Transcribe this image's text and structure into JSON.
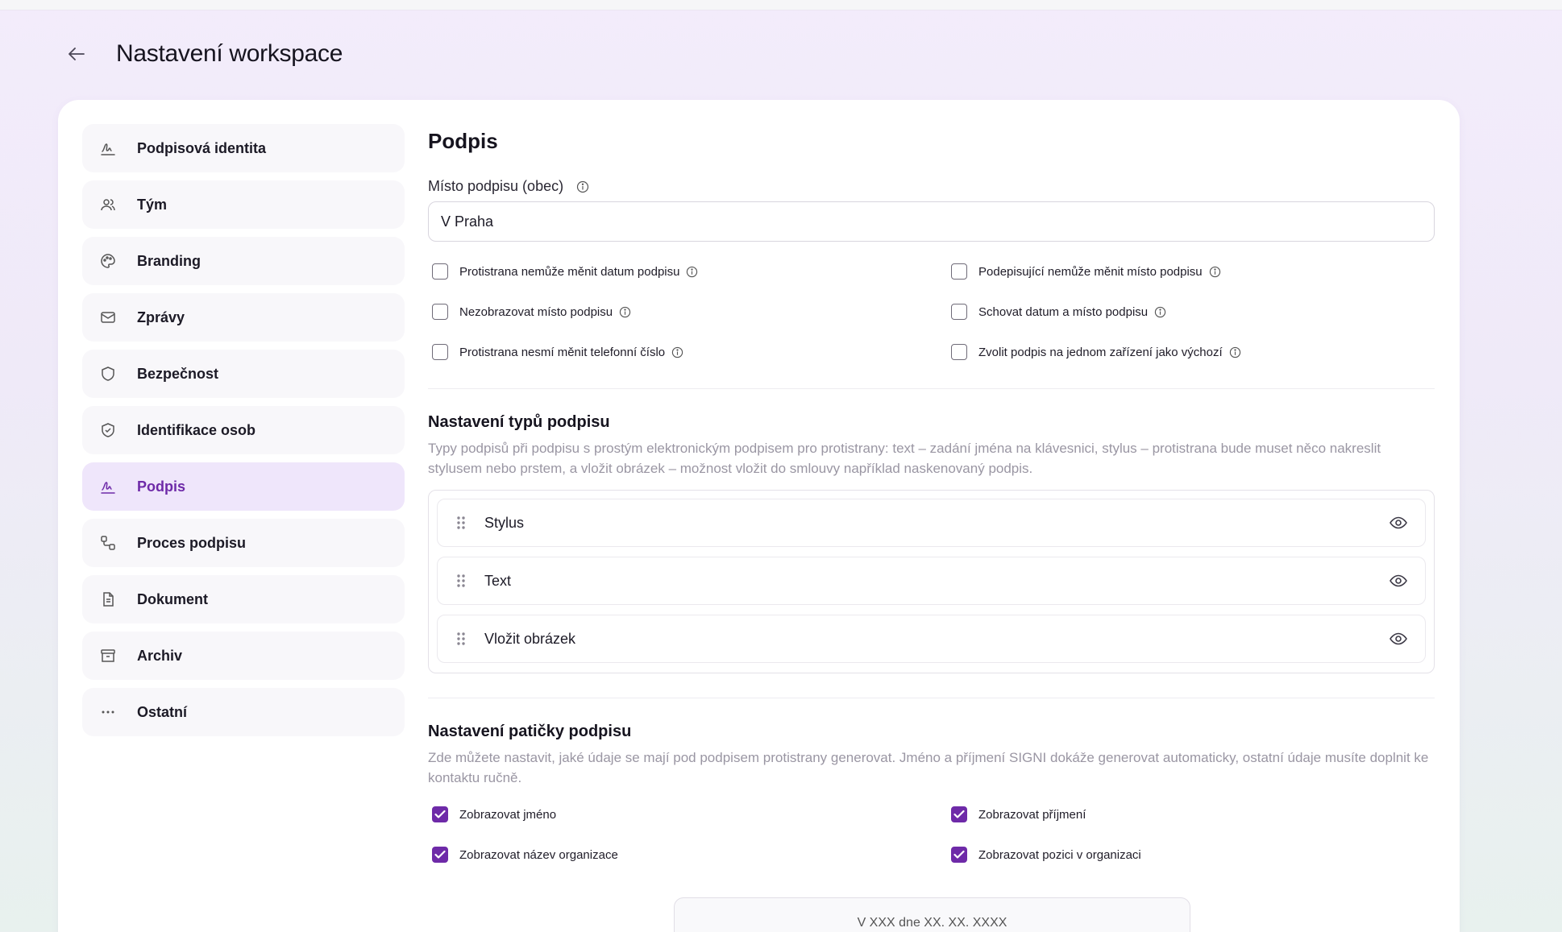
{
  "header": {
    "title": "Nastavení workspace"
  },
  "sidebar": {
    "items": [
      {
        "label": "Podpisová identita",
        "icon": "signature-icon"
      },
      {
        "label": "Tým",
        "icon": "users-icon"
      },
      {
        "label": "Branding",
        "icon": "palette-icon"
      },
      {
        "label": "Zprávy",
        "icon": "mail-icon"
      },
      {
        "label": "Bezpečnost",
        "icon": "shield-icon"
      },
      {
        "label": "Identifikace osob",
        "icon": "shield-check-icon"
      },
      {
        "label": "Podpis",
        "icon": "signature-icon",
        "active": true
      },
      {
        "label": "Proces podpisu",
        "icon": "workflow-icon"
      },
      {
        "label": "Dokument",
        "icon": "document-icon"
      },
      {
        "label": "Archiv",
        "icon": "archive-icon"
      },
      {
        "label": "Ostatní",
        "icon": "more-icon"
      }
    ]
  },
  "main": {
    "title": "Podpis",
    "place": {
      "label": "Místo podpisu (obec)",
      "value": "V Praha"
    },
    "options": [
      {
        "label": "Protistrana nemůže měnit datum podpisu",
        "checked": false
      },
      {
        "label": "Podepisující nemůže měnit místo podpisu",
        "checked": false
      },
      {
        "label": "Nezobrazovat místo podpisu",
        "checked": false
      },
      {
        "label": "Schovat datum a místo podpisu",
        "checked": false
      },
      {
        "label": "Protistrana nesmí měnit telefonní číslo",
        "checked": false
      },
      {
        "label": "Zvolit podpis na jednom zařízení jako výchozí",
        "checked": false
      }
    ],
    "types": {
      "title": "Nastavení typů podpisu",
      "description": "Typy podpisů při podpisu s prostým elektronickým podpisem pro protistrany: text – zadání jména na klávesnici, stylus – protistrana bude muset něco nakreslit stylusem nebo prstem, a vložit obrázek – možnost vložit do smlouvy například naskenovaný podpis.",
      "items": [
        {
          "label": "Stylus"
        },
        {
          "label": "Text"
        },
        {
          "label": "Vložit obrázek"
        }
      ]
    },
    "footer": {
      "title": "Nastavení patičky podpisu",
      "description": "Zde můžete nastavit, jaké údaje se mají pod podpisem protistrany generovat. Jméno a příjmení SIGNI dokáže generovat automaticky, ostatní údaje musíte doplnit ke kontaktu ručně.",
      "options": [
        {
          "label": "Zobrazovat jméno",
          "checked": true
        },
        {
          "label": "Zobrazovat příjmení",
          "checked": true
        },
        {
          "label": "Zobrazovat název organizace",
          "checked": true
        },
        {
          "label": "Zobrazovat pozici v organizaci",
          "checked": true
        }
      ],
      "preview_text": "V XXX dne XX. XX. XXXX"
    }
  },
  "colors": {
    "accent": "#6e2aa8",
    "active_item_bg": "#efe6fb",
    "muted_text": "#9a96a3"
  }
}
